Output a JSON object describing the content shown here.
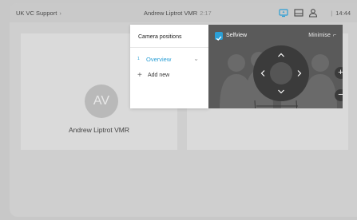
{
  "topbar": {
    "breadcrumb": "UK VC Support",
    "call_name": "Andrew Liptrot VMR",
    "call_duration": "2:17",
    "clock": "14:44",
    "separator": "|"
  },
  "tiles": {
    "left": {
      "initials": "AV",
      "name": "Andrew Liptrot VMR"
    }
  },
  "camera_panel": {
    "title": "Camera positions",
    "items": [
      {
        "index": "1",
        "label": "Overview"
      }
    ],
    "add_label": "Add new"
  },
  "selfview": {
    "label": "Selfview",
    "minimise_label": "Minimise",
    "checked": true
  },
  "icons": {
    "crumb_chevron": "chevron-right-icon",
    "share": "screen-share-icon",
    "layout": "layout-icon",
    "participants": "person-icon",
    "zoom_in": "plus-icon",
    "zoom_out": "minus-icon"
  },
  "colors": {
    "accent": "#2b9fd6",
    "panel_dark": "#5a5a5a",
    "background": "#cfcfcf"
  }
}
